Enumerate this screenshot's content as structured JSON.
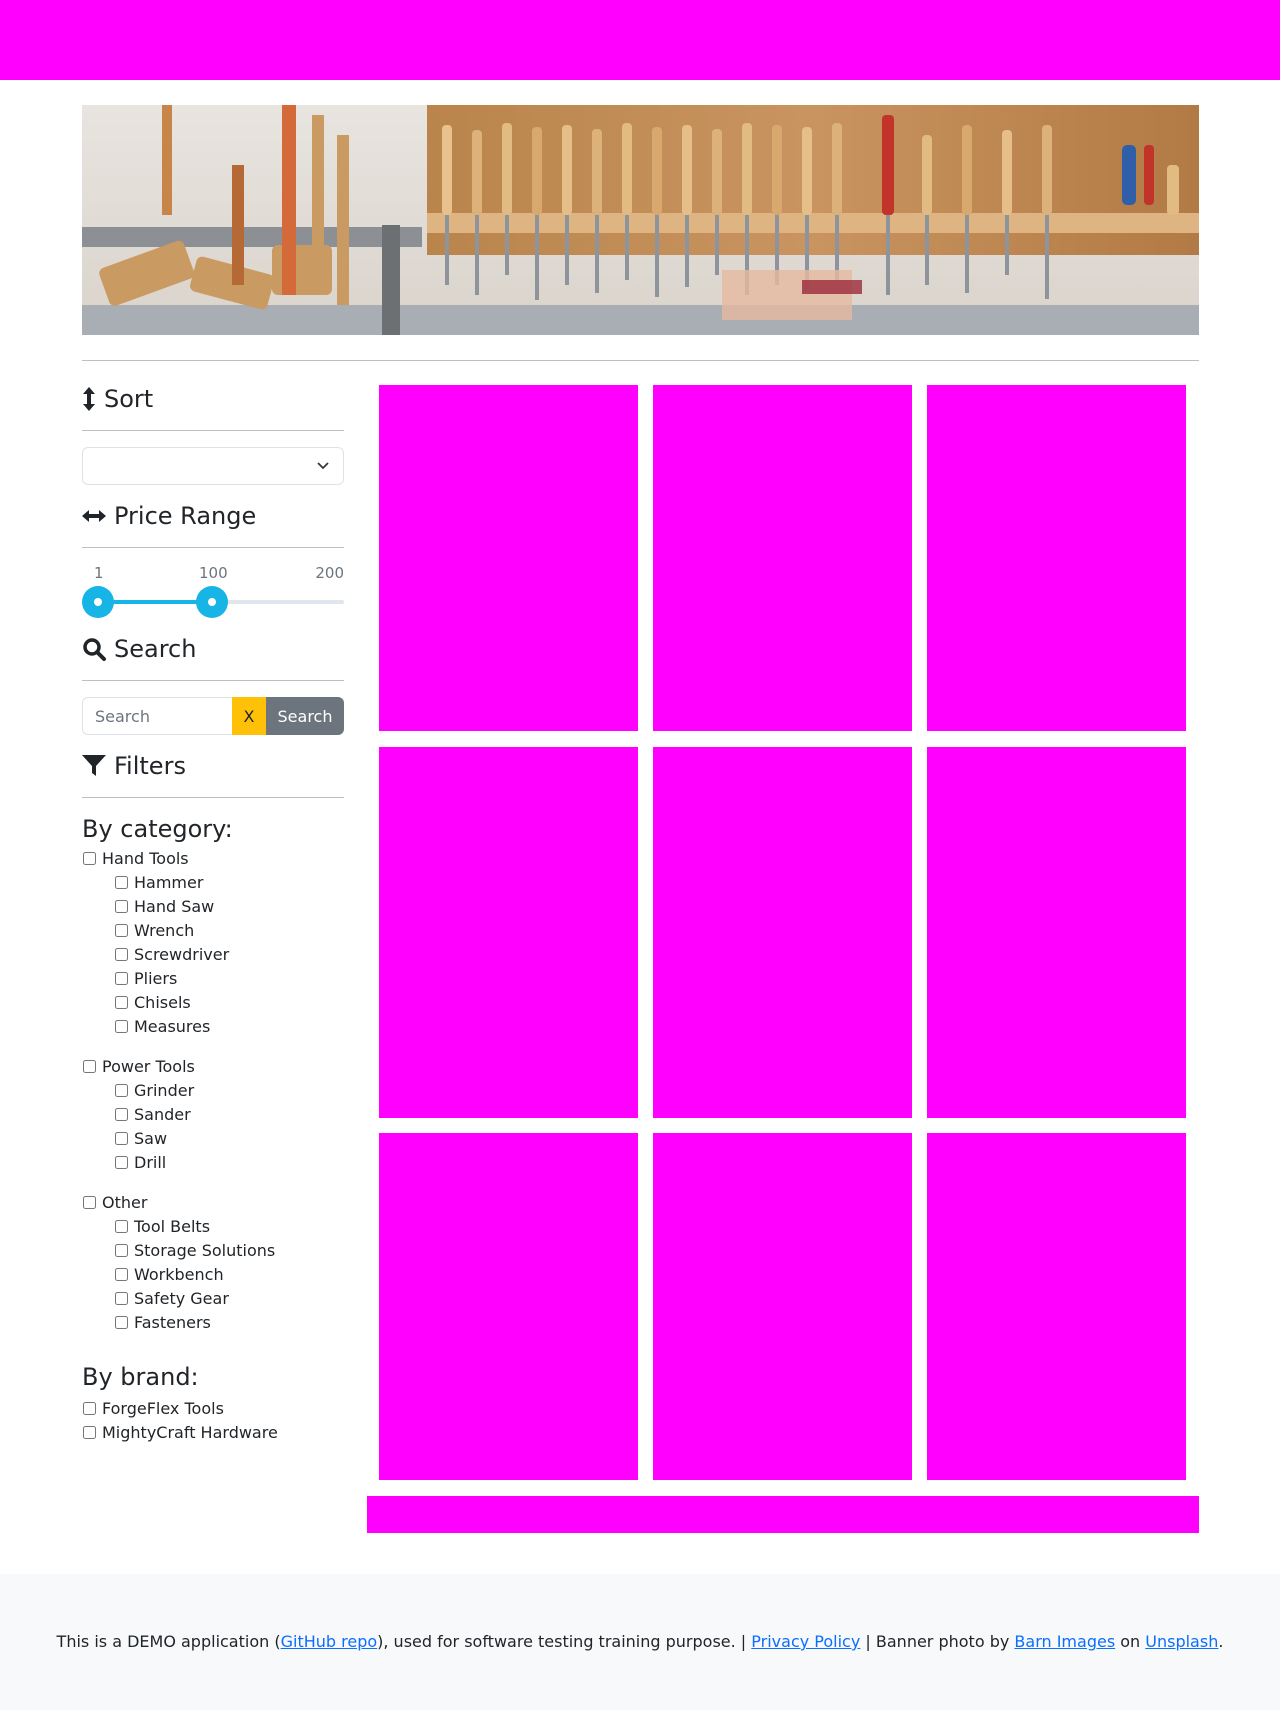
{
  "sidebar": {
    "sort": {
      "title": "Sort",
      "selected": ""
    },
    "price_range": {
      "title": "Price Range",
      "min_label": "1",
      "max_label": "200",
      "selected_max_label": "100",
      "min": 1,
      "max": 200,
      "low": 1,
      "high": 100
    },
    "search": {
      "title": "Search",
      "placeholder": "Search",
      "clear_label": "X",
      "button_label": "Search"
    },
    "filters": {
      "title": "Filters",
      "by_category": "By category:",
      "categories": [
        {
          "label": "Hand Tools",
          "children": [
            "Hammer",
            "Hand Saw",
            "Wrench",
            "Screwdriver",
            "Pliers",
            "Chisels",
            "Measures"
          ]
        },
        {
          "label": "Power Tools",
          "children": [
            "Grinder",
            "Sander",
            "Saw",
            "Drill"
          ]
        },
        {
          "label": "Other",
          "children": [
            "Tool Belts",
            "Storage Solutions",
            "Workbench",
            "Safety Gear",
            "Fasteners"
          ]
        }
      ],
      "by_brand": "By brand:",
      "brands": [
        "ForgeFlex Tools",
        "MightyCraft Hardware"
      ]
    }
  },
  "footer": {
    "text_1": "This is a DEMO application (",
    "github_link": "GitHub repo",
    "text_2": "), used for software testing training purpose. | ",
    "privacy_link": "Privacy Policy",
    "text_3": " | Banner photo by ",
    "barn_link": "Barn Images",
    "text_4": " on ",
    "unsplash_link": "Unsplash",
    "text_5": "."
  },
  "colors": {
    "placeholder": "#ff00ff",
    "accent": "#17b5e6",
    "warning": "#ffc107",
    "secondary": "#6c757d",
    "link": "#0d6efd"
  }
}
